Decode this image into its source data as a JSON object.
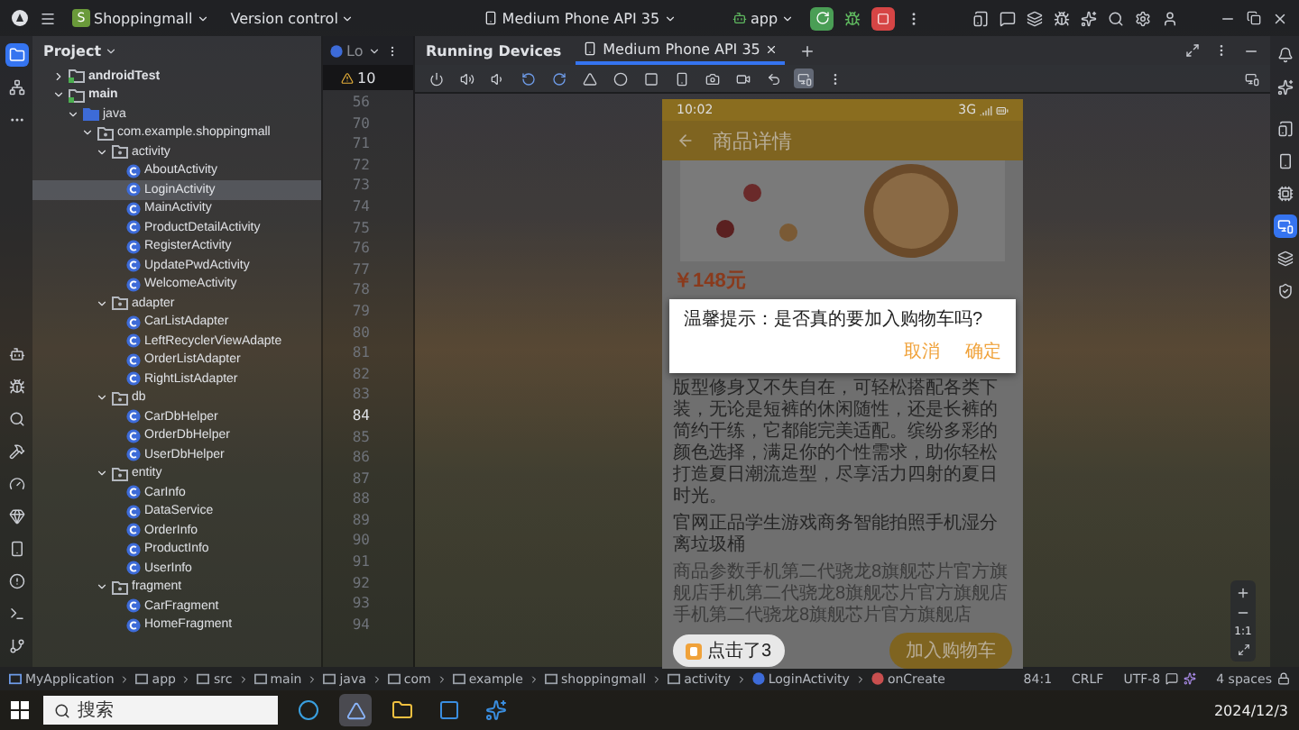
{
  "title_bar": {
    "project_badge": "S",
    "project": "Shoppingmall",
    "vcs": "Version control",
    "device": "Medium Phone API 35",
    "run_config": "app"
  },
  "left_strip": [
    {
      "selected": true
    },
    {
      "selected": false
    },
    {
      "selected": false
    },
    {
      "selected": false
    },
    {
      "selected": false
    },
    {
      "selected": false
    },
    {
      "selected": false
    },
    {
      "selected": false
    },
    {
      "selected": false
    },
    {
      "selected": false
    },
    {
      "selected": false
    },
    {
      "selected": false
    },
    {
      "selected": false
    }
  ],
  "project_panel": {
    "title": "Project",
    "tree": [
      {
        "label": "androidTest",
        "kind": "module",
        "expanded": false,
        "selected": false
      },
      {
        "label": "main",
        "kind": "module",
        "expanded": true,
        "selected": false,
        "children": [
          {
            "label": "java",
            "kind": "source",
            "expanded": true,
            "selected": false,
            "children": [
              {
                "label": "com.example.shoppingmall",
                "kind": "package",
                "expanded": true,
                "selected": false,
                "children": [
                  {
                    "label": "activity",
                    "kind": "package",
                    "expanded": true,
                    "selected": false,
                    "children": [
                      {
                        "label": "AboutActivity",
                        "kind": "class",
                        "selected": false
                      },
                      {
                        "label": "LoginActivity",
                        "kind": "class",
                        "selected": true
                      },
                      {
                        "label": "MainActivity",
                        "kind": "class",
                        "selected": false
                      },
                      {
                        "label": "ProductDetailActivity",
                        "kind": "class",
                        "selected": false
                      },
                      {
                        "label": "RegisterActivity",
                        "kind": "class",
                        "selected": false
                      },
                      {
                        "label": "UpdatePwdActivity",
                        "kind": "class",
                        "selected": false
                      },
                      {
                        "label": "WelcomeActivity",
                        "kind": "class",
                        "selected": false
                      }
                    ]
                  },
                  {
                    "label": "adapter",
                    "kind": "package",
                    "expanded": true,
                    "selected": false,
                    "children": [
                      {
                        "label": "CarListAdapter",
                        "kind": "class",
                        "selected": false
                      },
                      {
                        "label": "LeftRecyclerViewAdapte",
                        "kind": "class",
                        "selected": false
                      },
                      {
                        "label": "OrderListAdapter",
                        "kind": "class",
                        "selected": false
                      },
                      {
                        "label": "RightListAdapter",
                        "kind": "class",
                        "selected": false
                      }
                    ]
                  },
                  {
                    "label": "db",
                    "kind": "package",
                    "expanded": true,
                    "selected": false,
                    "children": [
                      {
                        "label": "CarDbHelper",
                        "kind": "class",
                        "selected": false
                      },
                      {
                        "label": "OrderDbHelper",
                        "kind": "class",
                        "selected": false
                      },
                      {
                        "label": "UserDbHelper",
                        "kind": "class",
                        "selected": false
                      }
                    ]
                  },
                  {
                    "label": "entity",
                    "kind": "package",
                    "expanded": true,
                    "selected": false,
                    "children": [
                      {
                        "label": "CarInfo",
                        "kind": "class",
                        "selected": false
                      },
                      {
                        "label": "DataService",
                        "kind": "class",
                        "selected": false
                      },
                      {
                        "label": "OrderInfo",
                        "kind": "class",
                        "selected": false
                      },
                      {
                        "label": "ProductInfo",
                        "kind": "class",
                        "selected": false
                      },
                      {
                        "label": "UserInfo",
                        "kind": "class",
                        "selected": false
                      }
                    ]
                  },
                  {
                    "label": "fragment",
                    "kind": "package",
                    "expanded": true,
                    "selected": false,
                    "children": [
                      {
                        "label": "CarFragment",
                        "kind": "class",
                        "selected": false
                      },
                      {
                        "label": "HomeFragment",
                        "kind": "class",
                        "selected": false
                      }
                    ]
                  }
                ]
              }
            ]
          }
        ]
      }
    ]
  },
  "editor": {
    "tab": "Lo",
    "warnings": "10",
    "line_numbers": [
      {
        "number": "56",
        "current": false
      },
      {
        "number": "70",
        "current": false
      },
      {
        "number": "71",
        "current": false
      },
      {
        "number": "72",
        "current": false
      },
      {
        "number": "73",
        "current": false
      },
      {
        "number": "74",
        "current": false
      },
      {
        "number": "75",
        "current": false
      },
      {
        "number": "76",
        "current": false
      },
      {
        "number": "77",
        "current": false
      },
      {
        "number": "78",
        "current": false
      },
      {
        "number": "79",
        "current": false
      },
      {
        "number": "80",
        "current": false
      },
      {
        "number": "81",
        "current": false
      },
      {
        "number": "82",
        "current": false
      },
      {
        "number": "83",
        "current": false
      },
      {
        "number": "84",
        "current": true
      },
      {
        "number": "85",
        "current": false
      },
      {
        "number": "86",
        "current": false
      },
      {
        "number": "87",
        "current": false
      },
      {
        "number": "88",
        "current": false
      },
      {
        "number": "89",
        "current": false
      },
      {
        "number": "90",
        "current": false
      },
      {
        "number": "91",
        "current": false
      },
      {
        "number": "92",
        "current": false
      },
      {
        "number": "93",
        "current": false
      },
      {
        "number": "94",
        "current": false
      }
    ]
  },
  "running_devices": {
    "title": "Running Devices",
    "tabs": [
      {
        "label": "Medium Phone API 35",
        "selected": true
      }
    ],
    "toolbar": [
      {
        "selected": false
      },
      {
        "selected": false
      },
      {
        "selected": false
      },
      {
        "selected": false
      },
      {
        "selected": false
      },
      {
        "selected": false
      },
      {
        "selected": false
      },
      {
        "selected": false
      },
      {
        "selected": false
      },
      {
        "selected": false
      },
      {
        "selected": false
      },
      {
        "selected": false
      },
      {
        "selected": true
      },
      {
        "selected": false
      }
    ],
    "zoom_label": "1:1"
  },
  "phone": {
    "time": "10:02",
    "network": "3G",
    "header": "商品详情",
    "price": "￥148元",
    "dialog": {
      "message": "温馨提示：是否真的要加入购物车吗?",
      "buttons": [
        "取消",
        "确定"
      ]
    },
    "description": "版型修身又不失自在，可轻松搭配各类下装，无论是短裤的休闲随性，还是长裤的简约干练，它都能完美适配。缤纷多彩的颜色选择，满足你的个性需求，助你轻松打造夏日潮流造型，尽享活力四射的夏日时光。",
    "title": "官网正品学生游戏商务智能拍照手机湿分离垃圾桶",
    "params": "商品参数手机第二代骁龙8旗舰芯片官方旗舰店手机第二代骁龙8旗舰芯片官方旗舰店手机第二代骁龙8旗舰芯片官方旗舰店",
    "toast": "点击了3",
    "cart_button": "加入购物车"
  },
  "right_strip": [
    {
      "selected": false
    },
    {
      "selected": false
    },
    {
      "selected": false
    },
    {
      "selected": false
    },
    {
      "selected": false
    },
    {
      "selected": true
    },
    {
      "selected": false
    },
    {
      "selected": false
    }
  ],
  "status_bar": {
    "breadcrumbs": [
      {
        "label": "MyApplication",
        "kind": "module"
      },
      {
        "label": "app",
        "kind": "folder"
      },
      {
        "label": "src",
        "kind": "folder"
      },
      {
        "label": "main",
        "kind": "folder"
      },
      {
        "label": "java",
        "kind": "folder"
      },
      {
        "label": "com",
        "kind": "folder"
      },
      {
        "label": "example",
        "kind": "folder"
      },
      {
        "label": "shoppingmall",
        "kind": "folder"
      },
      {
        "label": "activity",
        "kind": "folder"
      },
      {
        "label": "LoginActivity",
        "kind": "class"
      },
      {
        "label": "onCreate",
        "kind": "method"
      }
    ],
    "position": "84:1",
    "line_separator": "CRLF",
    "encoding": "UTF-8",
    "indent": "4 spaces"
  },
  "taskbar": {
    "search_placeholder": "搜索",
    "date": "2024/12/3"
  }
}
